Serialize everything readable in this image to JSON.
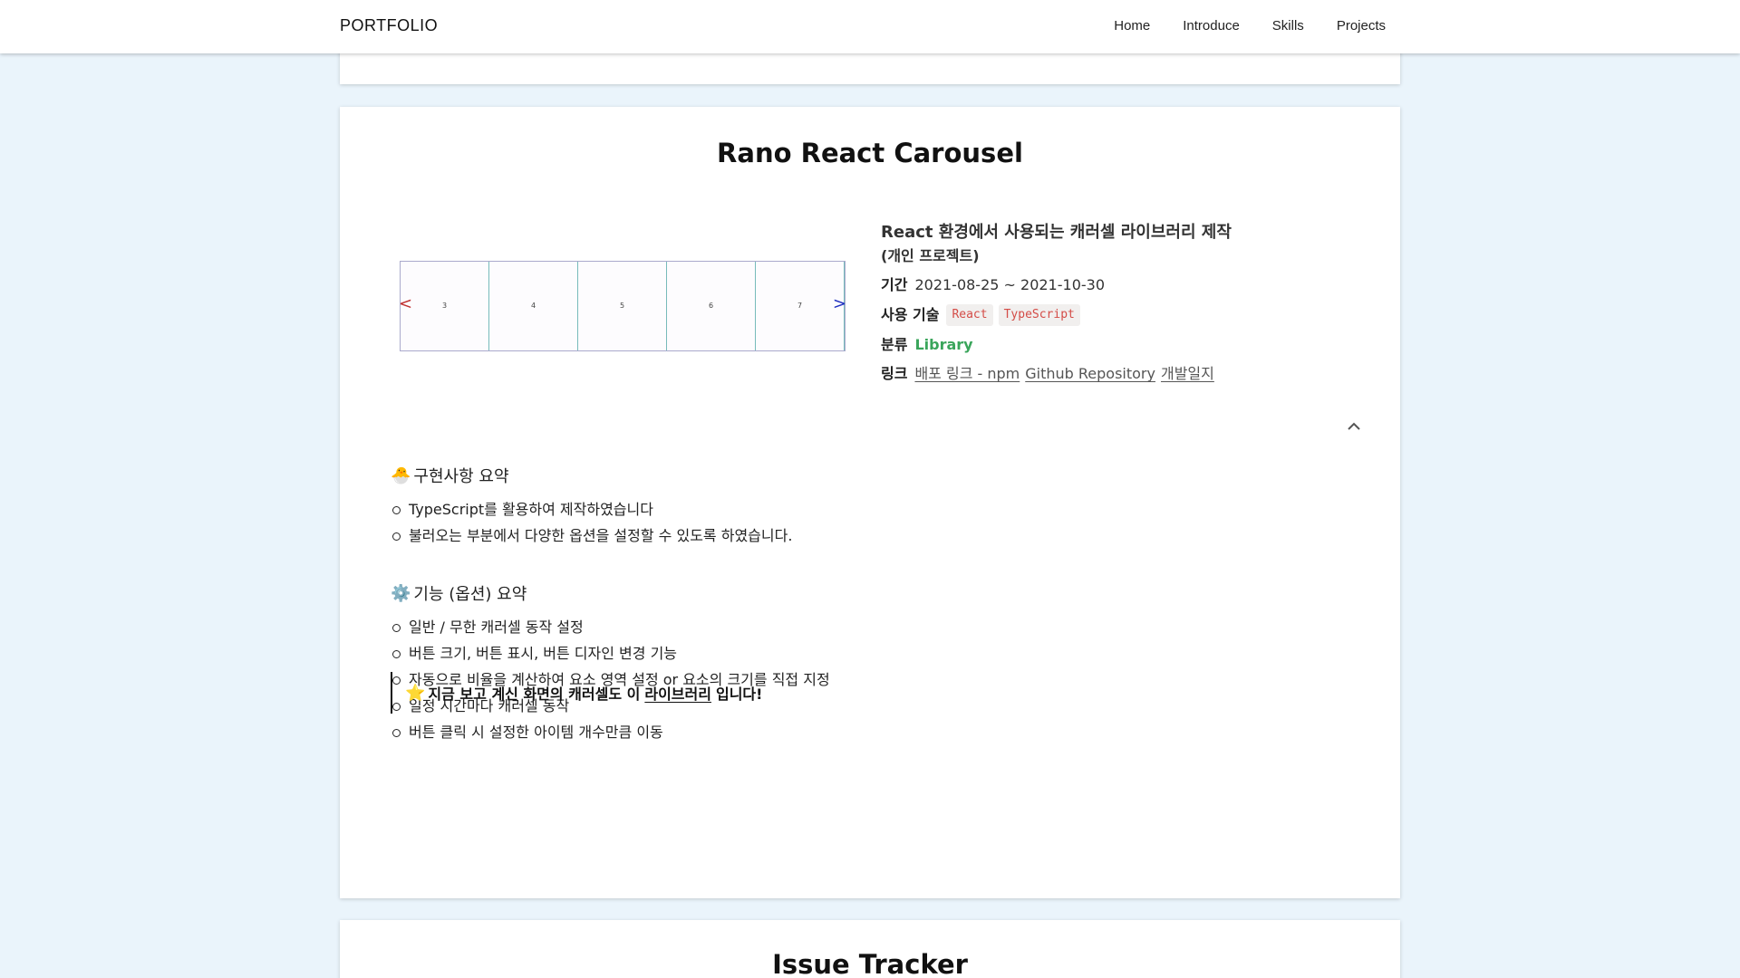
{
  "nav": {
    "brand": "PORTFOLIO",
    "links": [
      "Home",
      "Introduce",
      "Skills",
      "Projects"
    ]
  },
  "project": {
    "title": "Rano React Carousel",
    "carousel": {
      "slides": [
        "3",
        "4",
        "5",
        "6",
        "7"
      ],
      "prev_symbol": "<",
      "next_symbol": ">",
      "prev_color": "#c03030",
      "next_color": "#2030c0"
    },
    "info": {
      "heading": "React 환경에서 사용되는 캐러셀 라이브러리 제작",
      "subheading": "(개인 프로젝트)",
      "period_label": "기간",
      "period_value": "2021-08-25 ~ 2021-10-30",
      "tech_label": "사용 기술",
      "tech_tags": [
        "React",
        "TypeScript"
      ],
      "category_label": "분류",
      "category_value": "Library",
      "category_color": "#3aa55b",
      "link_label": "링크",
      "links": [
        "배포 링크 - npm",
        "Github Repository",
        "개발일지"
      ]
    },
    "collapse_icon": "chevron-up-icon",
    "summary": {
      "emoji": "🐣",
      "title": "구현사항 요약",
      "items": [
        "TypeScript를 활용하여 제작하였습니다",
        "불러오는 부분에서 다양한 옵션을 설정할 수 있도록 하였습니다."
      ]
    },
    "features": {
      "emoji": "⚙️",
      "title": "기능 (옵션) 요약",
      "items": [
        "일반 / 무한 캐러셀 동작 설정",
        "버튼 크기, 버튼 표시, 버튼 디자인 변경 기능",
        "자동으로 비율을 계산하여 요소 영역 설정 or 요소의 크기를 직접 지정",
        "일정 시간마다 캐러셀 동작",
        "버튼 클릭 시 설정한 아이템 개수만큼 이동"
      ]
    },
    "callout": {
      "emoji": "⭐",
      "text_before": "지금 보고 계신 화면의 캐러셀도 이",
      "text_link": "라이브러리",
      "text_after": "입니다!"
    }
  },
  "next_project": {
    "title": "Issue Tracker"
  }
}
